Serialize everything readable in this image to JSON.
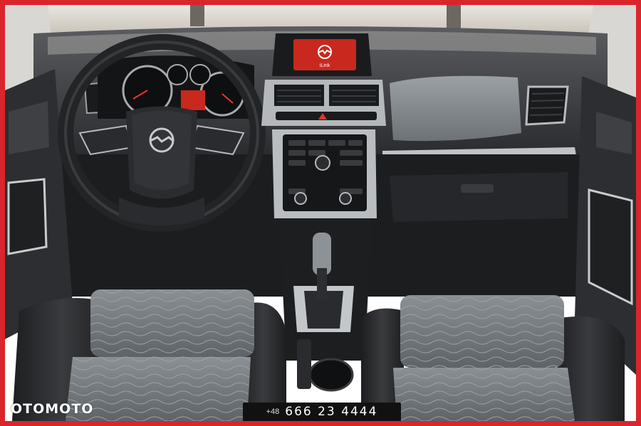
{
  "watermark": {
    "logo_text": "OTOMOTO"
  },
  "contact": {
    "prefix": "+48",
    "number": "666 23 4444"
  },
  "colors": {
    "frame_border": "#d9252b",
    "dash": "#2a2a2c",
    "seat_fabric": "#7d8286",
    "display": "#c9281e"
  },
  "infotainment": {
    "brand_logo": "opel-logo",
    "screen_text": "iLink"
  }
}
